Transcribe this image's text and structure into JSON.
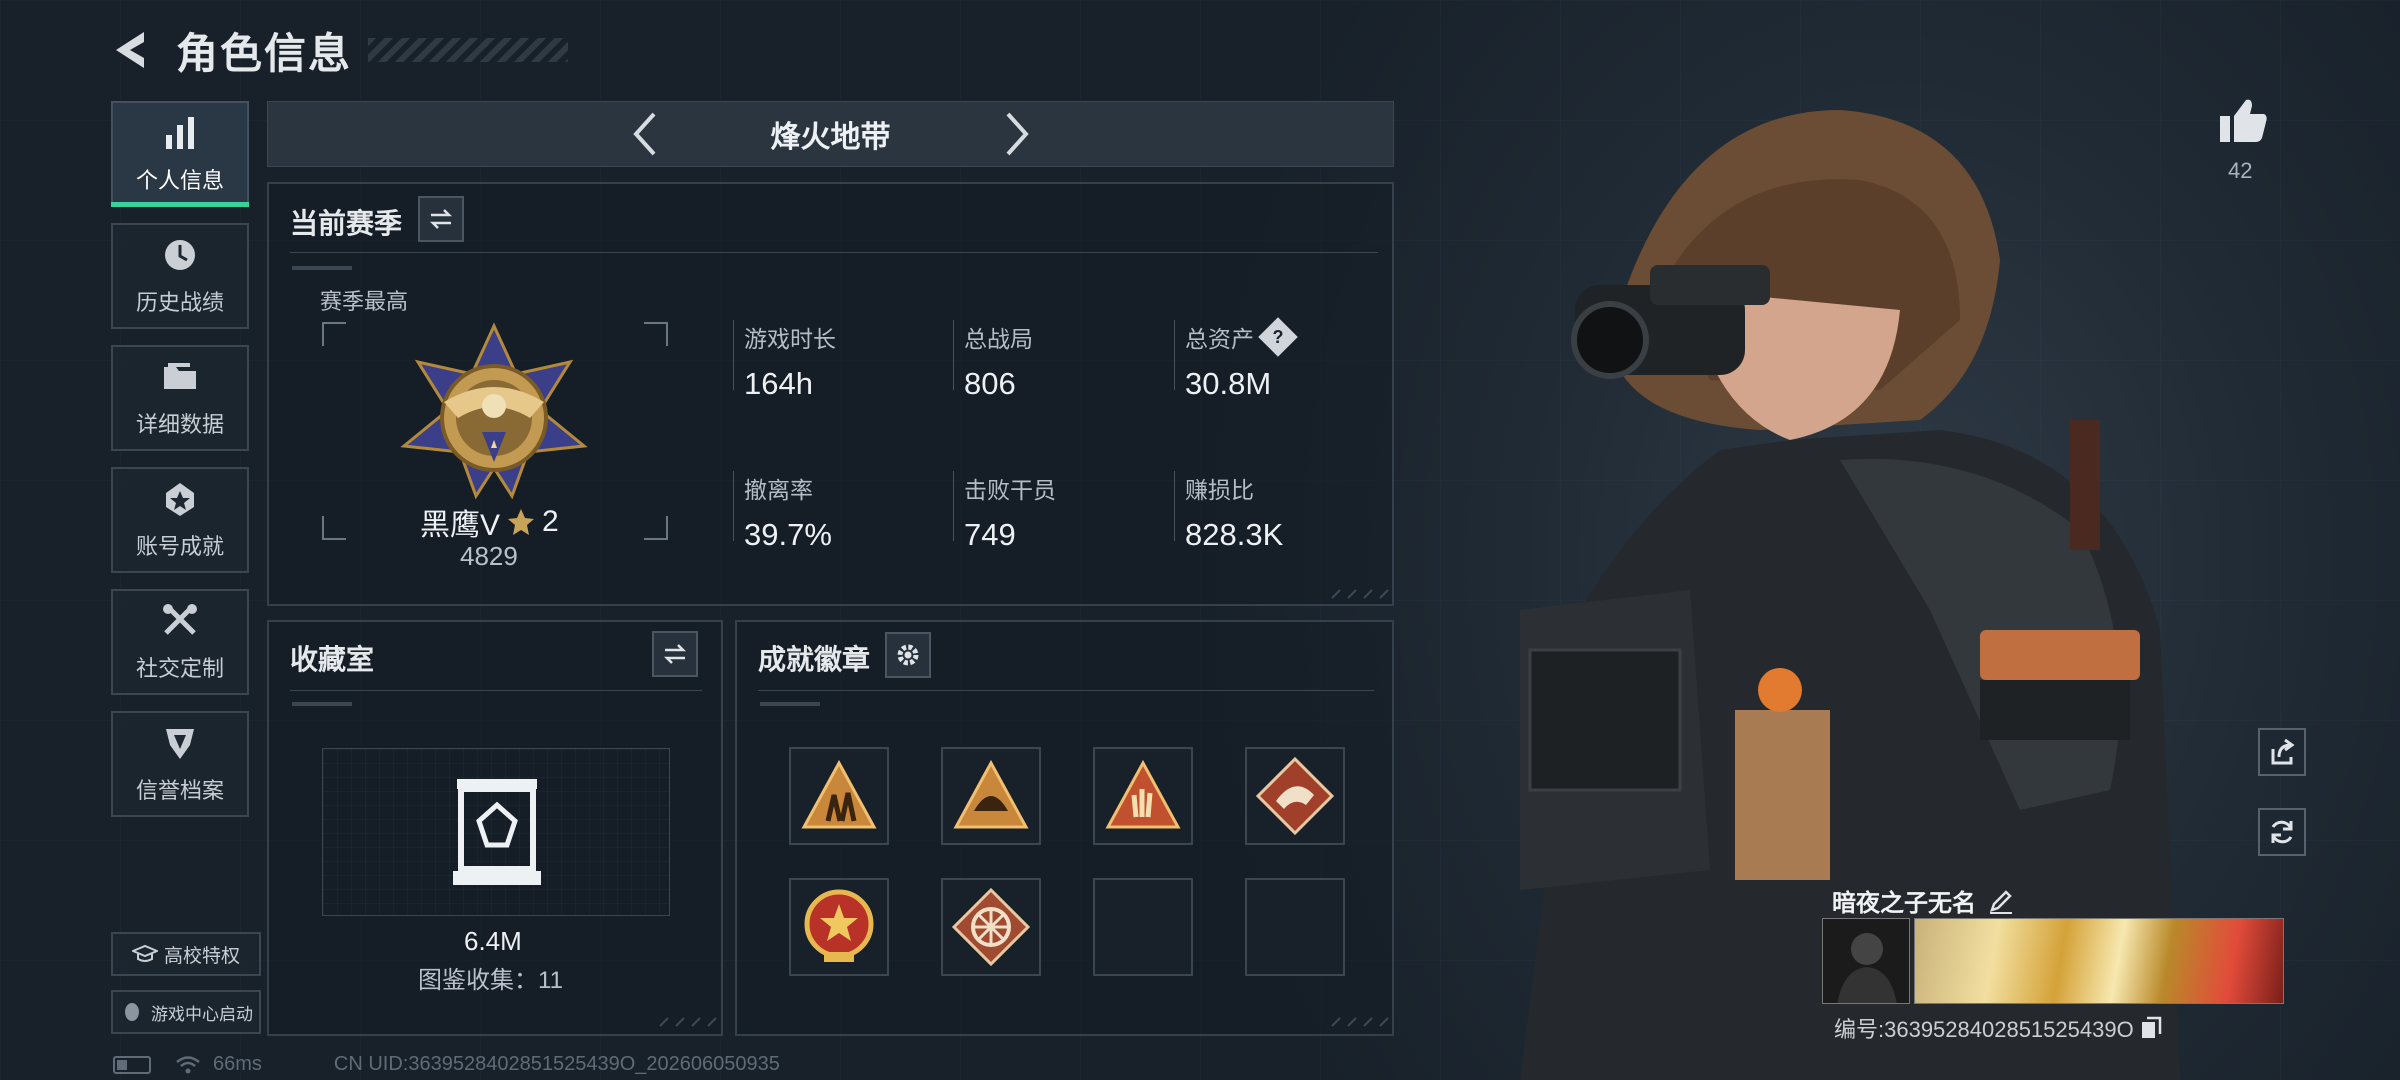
{
  "header": {
    "title": "角色信息"
  },
  "sidebar": {
    "items": [
      {
        "label": "个人信息",
        "icon": "bar-chart-icon",
        "active": true
      },
      {
        "label": "历史战绩",
        "icon": "history-clock-icon"
      },
      {
        "label": "详细数据",
        "icon": "folder-icon"
      },
      {
        "label": "账号成就",
        "icon": "achievement-icon"
      },
      {
        "label": "社交定制",
        "icon": "tools-icon"
      },
      {
        "label": "信誉档案",
        "icon": "shield-emblem-icon"
      }
    ],
    "campus_label": "高校特权",
    "game_center_label": "游戏中心启动"
  },
  "status_bar": {
    "ping": "66ms",
    "uid": "CN UID:3639528402851525439O_202606050935"
  },
  "mode": {
    "title": "烽火地带"
  },
  "season": {
    "title": "当前赛季",
    "best_label": "赛季最高",
    "rank_name": "黑鹰V",
    "rank_stars": "2",
    "rank_score": "4829",
    "stats": [
      {
        "label": "游戏时长",
        "value": "164h"
      },
      {
        "label": "总战局",
        "value": "806"
      },
      {
        "label": "总资产",
        "value": "30.8M",
        "help": "?"
      },
      {
        "label": "撤离率",
        "value": "39.7%"
      },
      {
        "label": "击败干员",
        "value": "749"
      },
      {
        "label": "赚损比",
        "value": "828.3K"
      }
    ]
  },
  "collection": {
    "title": "收藏室",
    "value": "6.4M",
    "count_label": "图鉴收集：11"
  },
  "badges": {
    "title": "成就徽章",
    "slots": [
      {
        "icon": "triangle-soldiers-badge-icon",
        "filled": true
      },
      {
        "icon": "triangle-helmet-badge-icon",
        "filled": true
      },
      {
        "icon": "triangle-hand-badge-icon",
        "filled": true
      },
      {
        "icon": "diamond-crocodile-badge-icon",
        "filled": true
      },
      {
        "icon": "round-star-medal-badge-icon",
        "filled": true
      },
      {
        "icon": "diamond-wheel-badge-icon",
        "filled": true
      },
      {
        "icon": "empty-slot",
        "filled": false
      },
      {
        "icon": "empty-slot",
        "filled": false
      }
    ]
  },
  "profile": {
    "likes": "42",
    "name": "暗夜之子无名",
    "id_label": "编号:3639528402851525439O"
  },
  "colors": {
    "accent": "#35d49a",
    "panel_border": "#34404c",
    "background": "#1a232d"
  }
}
